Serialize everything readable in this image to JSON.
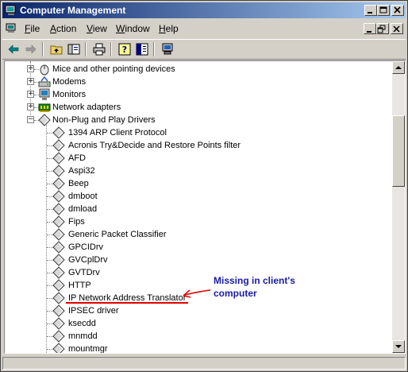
{
  "window": {
    "title": "Computer Management"
  },
  "menubar": {
    "items": [
      {
        "pre": "",
        "ul": "F",
        "post": "ile"
      },
      {
        "pre": "",
        "ul": "A",
        "post": "ction"
      },
      {
        "pre": "",
        "ul": "V",
        "post": "iew"
      },
      {
        "pre": "",
        "ul": "W",
        "post": "indow"
      },
      {
        "pre": "",
        "ul": "H",
        "post": "elp"
      }
    ]
  },
  "toolbar": {
    "icons": [
      "back-arrow-icon",
      "forward-arrow-icon",
      "up-folder-icon",
      "show-hide-tree-icon",
      "print-icon",
      "help-icon",
      "properties-icon",
      "computer-manage-icon"
    ]
  },
  "tree": {
    "categories": [
      {
        "label": "Mice and other pointing devices",
        "icon": "mouse-icon",
        "expanded": false
      },
      {
        "label": "Modems",
        "icon": "modem-icon",
        "expanded": false
      },
      {
        "label": "Monitors",
        "icon": "monitor-icon",
        "expanded": false
      },
      {
        "label": "Network adapters",
        "icon": "network-adapter-icon",
        "expanded": false
      },
      {
        "label": "Non-Plug and Play Drivers",
        "icon": "driver-icon",
        "expanded": true
      }
    ],
    "drivers": [
      "1394 ARP Client Protocol",
      "Acronis Try&Decide and Restore Points filter",
      "AFD",
      "Aspi32",
      "Beep",
      "dmboot",
      "dmload",
      "Fips",
      "Generic Packet Classifier",
      "GPCIDrv",
      "GVCplDrv",
      "GVTDrv",
      "HTTP",
      "IP Network Address Translator",
      "IPSEC driver",
      "ksecdd",
      "mnmdd",
      "mountmgr"
    ]
  },
  "annotation": {
    "line1": "Missing in client's",
    "line2": "computer",
    "color": "#1a1aa6",
    "arrow_color": "#e00000"
  }
}
